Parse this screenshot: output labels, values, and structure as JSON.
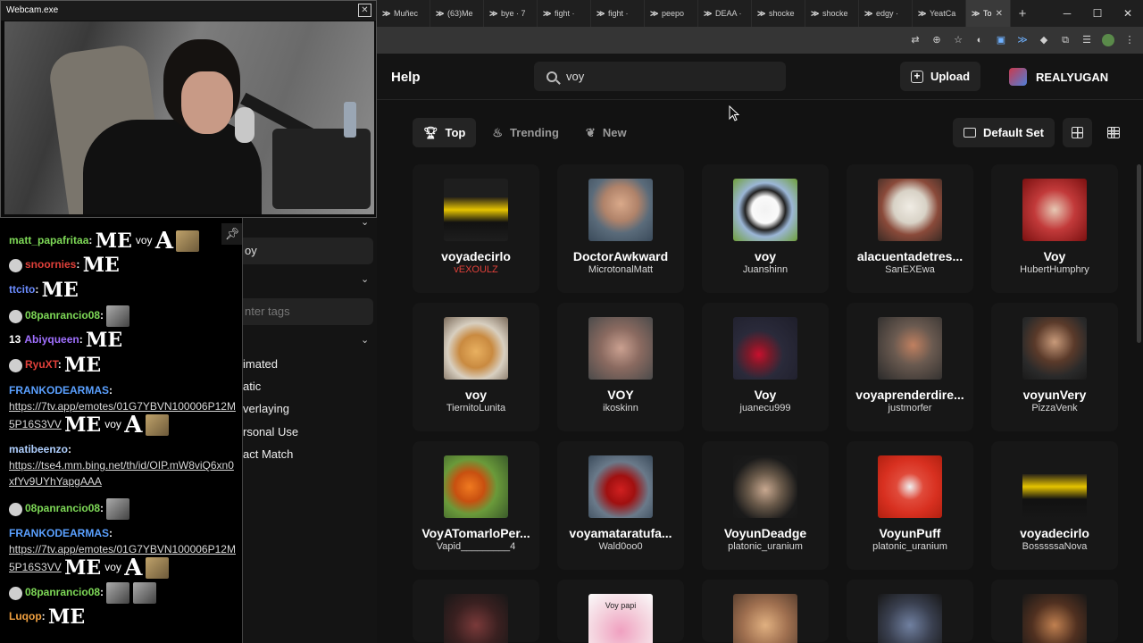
{
  "webcam": {
    "title": "Webcam.exe"
  },
  "browser": {
    "tabs": [
      {
        "label": "Muñec"
      },
      {
        "label": "(63)Me"
      },
      {
        "label": "bye · 7"
      },
      {
        "label": "fight ·"
      },
      {
        "label": "fight ·"
      },
      {
        "label": "peepo"
      },
      {
        "label": "DEAA ·"
      },
      {
        "label": "shocke"
      },
      {
        "label": "shocke"
      },
      {
        "label": "edgy ·"
      },
      {
        "label": "YeatCa"
      },
      {
        "label": "To",
        "active": true
      }
    ]
  },
  "header": {
    "help_label": "Help",
    "search_value": "voy",
    "upload_label": "Upload",
    "username": "REALYUGAN"
  },
  "filters": {
    "top": "Top",
    "trending": "Trending",
    "new": "New"
  },
  "default_set_label": "Default Set",
  "sidebar": {
    "search_value": "oy",
    "tags_placeholder": "nter tags",
    "options": [
      "imated",
      "atic",
      "verlaying",
      "rsonal Use",
      "act Match"
    ]
  },
  "emotes": [
    {
      "name": "voyadecirlo",
      "author": "vEXOULZ",
      "author_color": "#e0403a",
      "thumb": "linear-gradient(180deg,#1e1e1e 0%,#1e1e1e 30%,#2a2418 30%,#e6c400 50%,#111 70%,#1e1e1e 100%)"
    },
    {
      "name": "DoctorAwkward",
      "author": "MicrotonalMatt",
      "thumb": "radial-gradient(circle at 50% 40%,#d9a98a 0%,#b0836a 35%,#5a6b7a 60%,#3a4a5a 100%)"
    },
    {
      "name": "voy",
      "author": "Juanshinn",
      "thumb": "radial-gradient(circle at 50% 50%,#f2f2f2 0%,#fafafa 30%,#222 45%,#9bb6d6 60%,#6f9f3a 100%)"
    },
    {
      "name": "alacuentadetres...",
      "author": "SanEXEwa",
      "thumb": "radial-gradient(circle at 50% 45%,#f0ece4 0%,#d8d2c6 35%,#8a4a3a 60%,#3a2a24 100%)"
    },
    {
      "name": "Voy",
      "author": "HubertHumphry",
      "thumb": "radial-gradient(circle at 50% 50%,#e6c8b4 0%,#c23a3a 45%,#7a1010 100%)"
    },
    {
      "name": "voy",
      "author": "TiernitoLunita",
      "thumb": "radial-gradient(circle at 50% 55%,#e8b060 0%,#c98a40 35%,#d8cfc0 60%,#7a6a5a 100%)"
    },
    {
      "name": "VOY",
      "author": "ikoskinn",
      "thumb": "radial-gradient(circle at 50% 50%,#caa090 0%,#8a6a60 45%,#4a4a4a 100%)"
    },
    {
      "name": "Voy",
      "author": "juanecu999",
      "thumb": "radial-gradient(circle at 40% 60%,#c8102e 0%,#7a1a2a 20%,#2a2a3a 45%,#1e1e2a 100%)"
    },
    {
      "name": "voyaprenderdire...",
      "author": "justmorfer",
      "thumb": "radial-gradient(circle at 55% 45%,#c08060 0%,#6a5a50 40%,#2a2a2a 100%)"
    },
    {
      "name": "voyunVery",
      "author": "PizzaVenk",
      "thumb": "radial-gradient(circle at 50% 40%,#c89a7a 0%,#5a3a2a 40%,#2a2a2a 70%,#1a1a1a 100%)"
    },
    {
      "name": "VoyATomarloPer...",
      "author": "Vapid_________4",
      "thumb": "radial-gradient(circle at 40% 50%,#f07a20 0%,#c85010 30%,#6a9a3a 55%,#3a5a2a 100%)"
    },
    {
      "name": "voyamataratufa...",
      "author": "Wald0oo0",
      "thumb": "radial-gradient(circle at 50% 55%,#d02020 0%,#a01010 30%,#6a7a8a 60%,#3a4a5a 100%)"
    },
    {
      "name": "VoyunDeadge",
      "author": "platonic_uranium",
      "thumb": "radial-gradient(circle at 50% 55%,#c8a890 0%,#6a5a4a 35%,#1a1a1a 70%,#171717 100%)"
    },
    {
      "name": "VoyunPuff",
      "author": "platonic_uranium",
      "thumb": "radial-gradient(circle at 50% 50%,#f0f0f0 0%,#e04a3a 30%,#d83020 60%,#b02010 100%)"
    },
    {
      "name": "voyadecirlo",
      "author": "BosssssaNova",
      "thumb": "linear-gradient(180deg,#171717 0%,#171717 30%,#2a2418 30%,#e6c400 50%,#111 70%,#171717 100%)"
    },
    {
      "name": "",
      "author": "",
      "thumb": "radial-gradient(circle at 50% 50%,#7a3a3a 0%,#3a2020 50%,#171717 100%)"
    },
    {
      "name": "",
      "author": "",
      "thumb": "radial-gradient(circle at 50% 60%,#f0a0c0 0%,#f4d0dc 50%,#fafafa 100%)",
      "caption": "Voy papi"
    },
    {
      "name": "",
      "author": "",
      "thumb": "radial-gradient(circle at 50% 50%,#e0b080 0%,#a07050 50%,#5a4030 100%)"
    },
    {
      "name": "",
      "author": "",
      "thumb": "radial-gradient(circle at 50% 50%,#7080a0 0%,#3a4050 50%,#171717 100%)"
    },
    {
      "name": "",
      "author": "",
      "thumb": "radial-gradient(circle at 50% 50%,#c08050 0%,#503020 50%,#171717 100%)"
    }
  ],
  "chat": {
    "messages": [
      {
        "user": "matt_papafritaa",
        "color": "#7ed957",
        "text": "voy"
      },
      {
        "user": "snoornies",
        "color": "#e0403a",
        "text": ""
      },
      {
        "user": "ttcito",
        "color": "#6b8cff",
        "text": ""
      },
      {
        "user": "08panrancio08",
        "color": "#7ed957",
        "text": ""
      },
      {
        "user": "Abiyqueen",
        "color": "#a070ff",
        "prefix": "13",
        "text": ""
      },
      {
        "user": "RyuXT",
        "color": "#e0403a",
        "text": ""
      },
      {
        "user": "FRANKODEARMAS",
        "color": "#5aa0ff",
        "link": "https://7tv.app/emotes/01G7YBVN100006P12M5P16S3VV",
        "text": "voy"
      },
      {
        "user": "matibeenzo",
        "color": "#b0d0ff",
        "link": "https://tse4.mm.bing.net/th/id/OIP.mW8viQ6xn0xfYv9UYhYapgAAA"
      },
      {
        "user": "08panrancio08",
        "color": "#7ed957",
        "text": ""
      },
      {
        "user": "FRANKODEARMAS",
        "color": "#5aa0ff",
        "link": "https://7tv.app/emotes/01G7YBVN100006P12M5P16S3VV",
        "text": "voy"
      },
      {
        "user": "08panrancio08",
        "color": "#7ed957",
        "text": ""
      },
      {
        "user": "Luqop",
        "color": "#f0a040",
        "text": ""
      }
    ],
    "emote_text": "ME",
    "emote_letter": "A"
  }
}
